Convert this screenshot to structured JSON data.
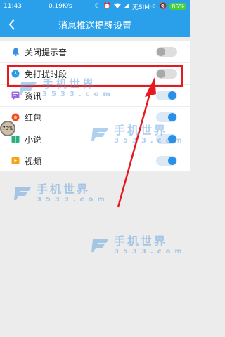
{
  "status_bar": {
    "time": "11:43",
    "speed": "0.19K/s",
    "carrier": "无SIM卡",
    "battery": "85%"
  },
  "nav": {
    "title": "消息推送提醒设置"
  },
  "settings": [
    {
      "label": "关闭提示音",
      "icon": "bell-icon",
      "toggle": "off"
    },
    {
      "label": "免打扰时段",
      "icon": "clock-icon",
      "toggle": "off"
    },
    {
      "label": "资讯",
      "icon": "chat-icon",
      "toggle": "on"
    },
    {
      "label": "红包",
      "icon": "red-packet-icon",
      "toggle": "on"
    },
    {
      "label": "小说",
      "icon": "book-icon",
      "toggle": "on"
    },
    {
      "label": "视频",
      "icon": "video-icon",
      "toggle": "on"
    }
  ],
  "float_badge": "70%",
  "watermark": {
    "title": "手机世界",
    "sub": "3533.com"
  },
  "colors": {
    "primary": "#2aa0ea",
    "highlight": "#e5191e",
    "toggle_on": "#2a8fe6"
  }
}
